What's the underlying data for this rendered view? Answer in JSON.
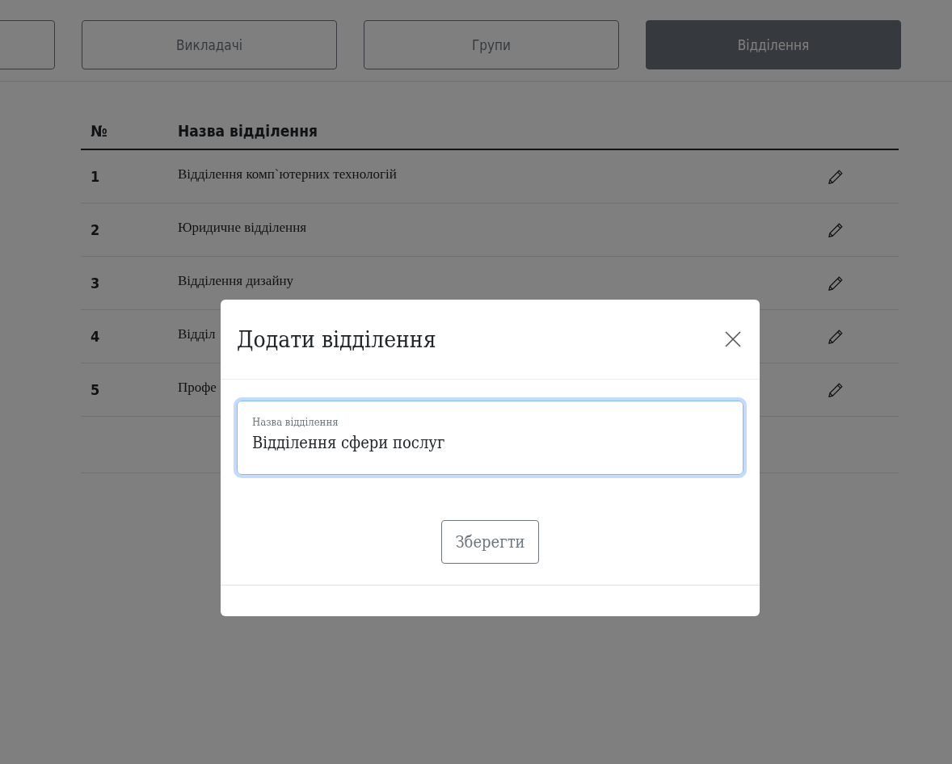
{
  "tabs": [
    {
      "selected": false
    },
    {
      "label": "Викладачі",
      "selected": false
    },
    {
      "label": "Групи",
      "selected": false
    },
    {
      "label": "Відділення",
      "selected": true
    }
  ],
  "table": {
    "columns": [
      "№",
      "Назва відділення"
    ],
    "rows": [
      {
        "number": "1",
        "name": "Відділення комп`ютерних технологій"
      },
      {
        "number": "2",
        "name": "Юридичне відділення"
      },
      {
        "number": "3",
        "name": "Відділення дизайну"
      },
      {
        "number": "4",
        "name": "Відділ"
      },
      {
        "number": "5",
        "name": "Профе"
      }
    ]
  },
  "modal": {
    "title": "Додати відділення",
    "field": {
      "label": "Назва відділення",
      "value": "Відділення сфери послуг"
    },
    "button": "Зберегти"
  }
}
